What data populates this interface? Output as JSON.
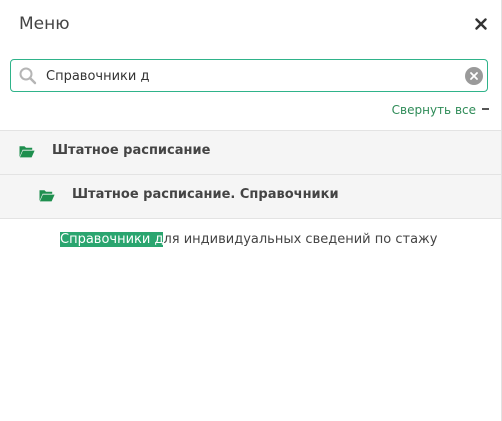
{
  "header": {
    "title": "Меню"
  },
  "search": {
    "value": "Справочники д",
    "placeholder": ""
  },
  "collapse_all": {
    "label": "Свернуть все"
  },
  "tree": {
    "level1": {
      "label": "Штатное расписание"
    },
    "level2": {
      "label": "Штатное расписание. Справочники"
    },
    "leaf": {
      "highlight": "Справочники д",
      "rest": "ля индивидуальных сведений по стажу"
    }
  },
  "colors": {
    "accent": "#2fb38a",
    "folder": "#1e8f4e",
    "highlight_bg": "#2aa56f",
    "link": "#2e8b57"
  },
  "icons": [
    "close-icon",
    "search-icon",
    "clear-icon",
    "minus-icon",
    "folder-open-icon"
  ]
}
